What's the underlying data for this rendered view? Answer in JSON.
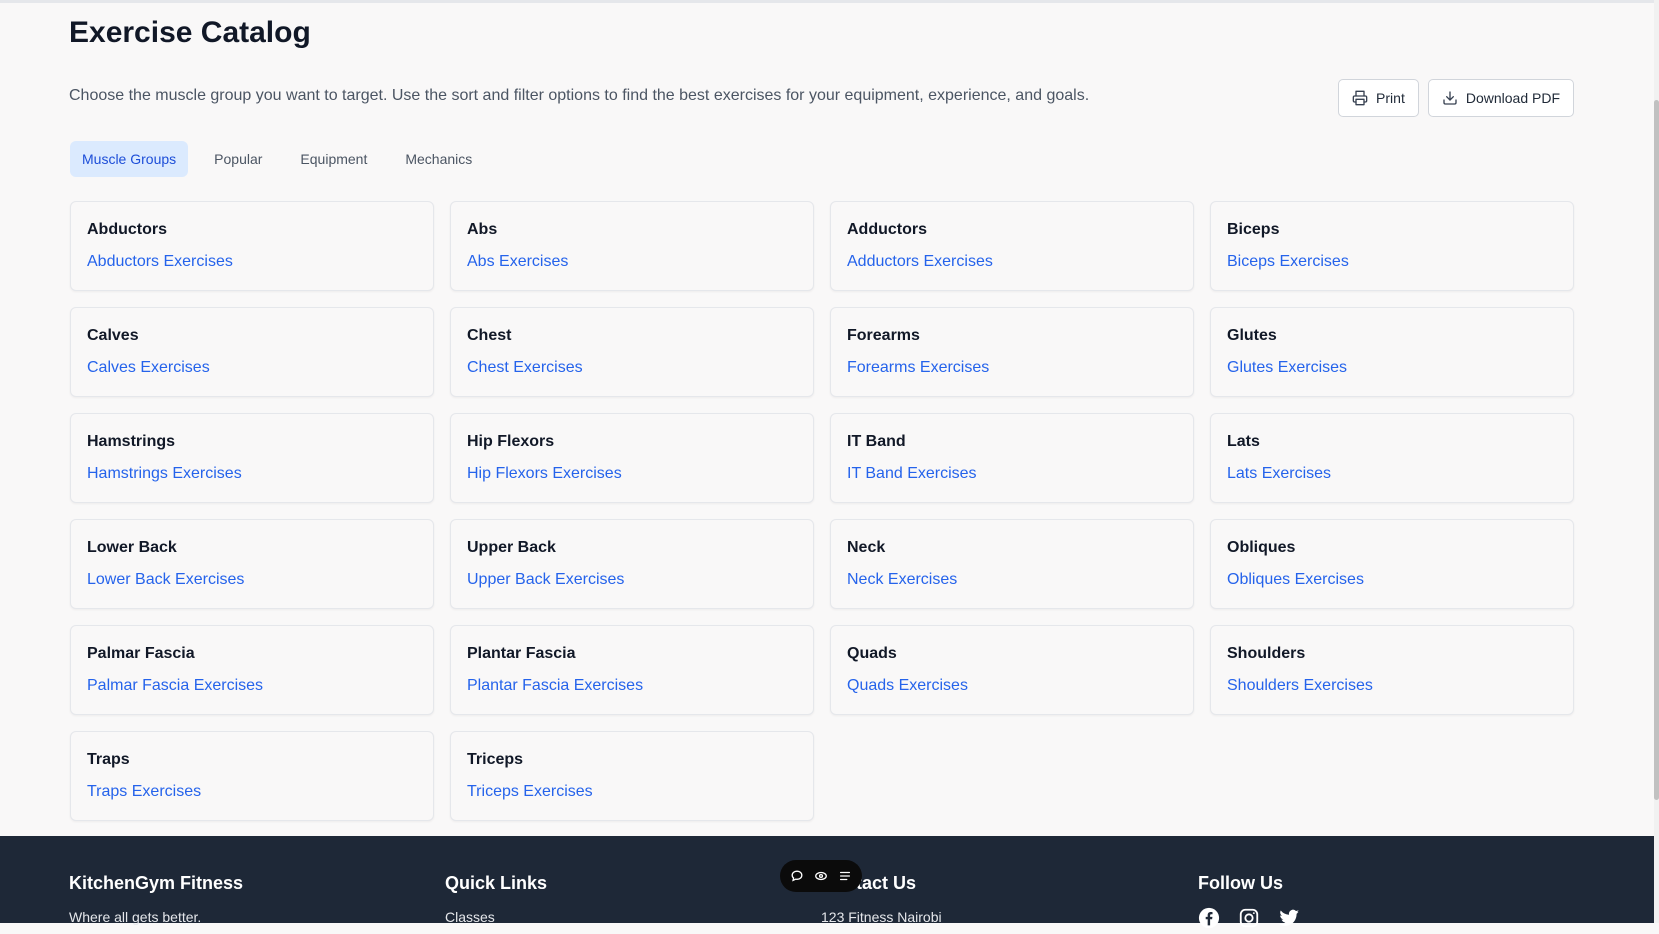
{
  "page": {
    "title": "Exercise Catalog",
    "intro": "Choose the muscle group you want to target. Use the sort and filter options to find the best exercises for your equipment, experience, and goals."
  },
  "actions": {
    "print_label": "Print",
    "download_label": "Download PDF"
  },
  "tabs": [
    {
      "label": "Muscle Groups",
      "active": true
    },
    {
      "label": "Popular",
      "active": false
    },
    {
      "label": "Equipment",
      "active": false
    },
    {
      "label": "Mechanics",
      "active": false
    }
  ],
  "groups": [
    {
      "name": "Abductors",
      "link": "Abductors Exercises"
    },
    {
      "name": "Abs",
      "link": "Abs Exercises"
    },
    {
      "name": "Adductors",
      "link": "Adductors Exercises"
    },
    {
      "name": "Biceps",
      "link": "Biceps Exercises"
    },
    {
      "name": "Calves",
      "link": "Calves Exercises"
    },
    {
      "name": "Chest",
      "link": "Chest Exercises"
    },
    {
      "name": "Forearms",
      "link": "Forearms Exercises"
    },
    {
      "name": "Glutes",
      "link": "Glutes Exercises"
    },
    {
      "name": "Hamstrings",
      "link": "Hamstrings Exercises"
    },
    {
      "name": "Hip Flexors",
      "link": "Hip Flexors Exercises"
    },
    {
      "name": "IT Band",
      "link": "IT Band Exercises"
    },
    {
      "name": "Lats",
      "link": "Lats Exercises"
    },
    {
      "name": "Lower Back",
      "link": "Lower Back Exercises"
    },
    {
      "name": "Upper Back",
      "link": "Upper Back Exercises"
    },
    {
      "name": "Neck",
      "link": "Neck Exercises"
    },
    {
      "name": "Obliques",
      "link": "Obliques Exercises"
    },
    {
      "name": "Palmar Fascia",
      "link": "Palmar Fascia Exercises"
    },
    {
      "name": "Plantar Fascia",
      "link": "Plantar Fascia Exercises"
    },
    {
      "name": "Quads",
      "link": "Quads Exercises"
    },
    {
      "name": "Shoulders",
      "link": "Shoulders Exercises"
    },
    {
      "name": "Traps",
      "link": "Traps Exercises"
    },
    {
      "name": "Triceps",
      "link": "Triceps Exercises"
    }
  ],
  "footer": {
    "brand": {
      "title": "KitchenGym Fitness",
      "tagline": "Where all gets better."
    },
    "quick_links": {
      "title": "Quick Links",
      "first_item": "Classes"
    },
    "contact": {
      "title": "Contact Us",
      "address": "123 Fitness Nairobi"
    },
    "follow": {
      "title": "Follow Us",
      "icons": [
        "facebook-icon",
        "instagram-icon",
        "twitter-icon"
      ]
    }
  },
  "colors": {
    "accent": "#2563eb",
    "tab_active_bg": "#dbeafe",
    "footer_bg": "#1e2837"
  }
}
